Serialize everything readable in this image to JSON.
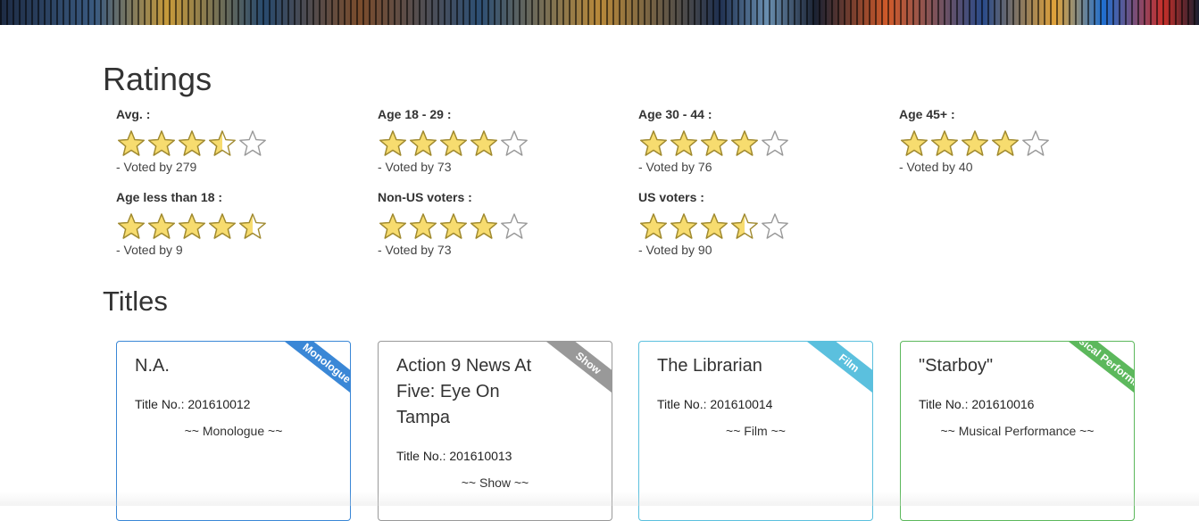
{
  "ratings": {
    "title": "Ratings",
    "items": [
      {
        "label": "Avg. :",
        "stars": 3.5,
        "votes": "- Voted by 279"
      },
      {
        "label": "Age 18 - 29 :",
        "stars": 4,
        "votes": "- Voted by 73"
      },
      {
        "label": "Age 30 - 44 :",
        "stars": 4,
        "votes": "- Voted by 76"
      },
      {
        "label": "Age 45+ :",
        "stars": 4,
        "votes": "- Voted by 40"
      },
      {
        "label": "Age less than 18 :",
        "stars": 4.5,
        "votes": "- Voted by 9"
      },
      {
        "label": "Non-US voters :",
        "stars": 4,
        "votes": "- Voted by 73"
      },
      {
        "label": "US voters :",
        "stars": 3.5,
        "votes": "- Voted by 90"
      }
    ],
    "star_fill_color": "#f7dc6f",
    "star_stroke_color": "#a08a30",
    "star_empty_color": "#999999"
  },
  "titles": {
    "title": "Titles",
    "cards": [
      {
        "name": "N.A.",
        "title_no": "Title No.: 201610012",
        "type": "~~ Monologue ~~",
        "ribbon": "Monologue",
        "ribbon_color": "#3a87d6",
        "border_color": "#3a87d6"
      },
      {
        "name": "Action 9 News At Five: Eye On Tampa",
        "title_no": "Title No.: 201610013",
        "type": "~~ Show ~~",
        "ribbon": "Show",
        "ribbon_color": "#999999",
        "border_color": "#999999"
      },
      {
        "name": "The Librarian",
        "title_no": "Title No.: 201610014",
        "type": "~~ Film ~~",
        "ribbon": "Film",
        "ribbon_color": "#5bc0de",
        "border_color": "#5bc0de"
      },
      {
        "name": "\"Starboy\"",
        "title_no": "Title No.: 201610016",
        "type": "~~ Musical Performance ~~",
        "ribbon": "Musical Performance",
        "ribbon_color": "#5cb85c",
        "border_color": "#5cb85c"
      }
    ]
  }
}
